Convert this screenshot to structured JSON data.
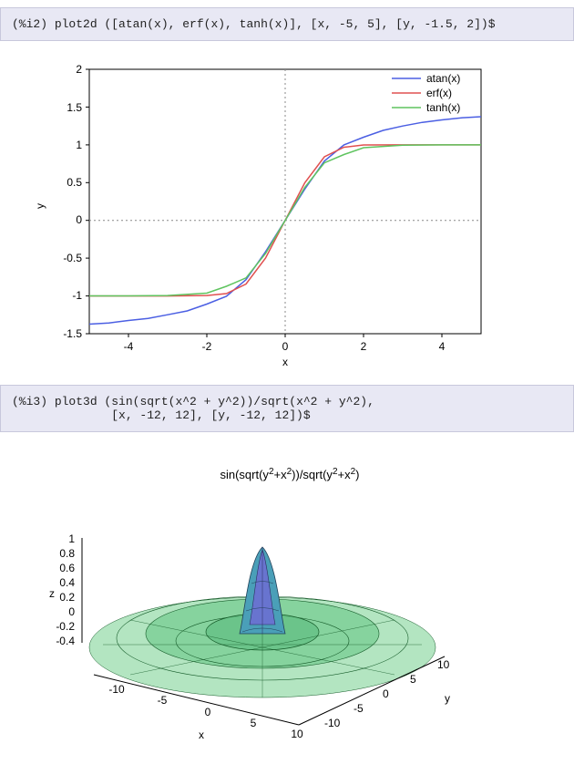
{
  "code1": {
    "prompt": "(%i2)",
    "command": "plot2d ([atan(x), erf(x), tanh(x)], [x, -5, 5], [y, -1.5, 2])$"
  },
  "code2": {
    "prompt": "(%i3)",
    "line1": "plot3d (sin(sqrt(x^2 + y^2))/sqrt(x^2 + y^2),",
    "line2": "        [x, -12, 12], [y, -12, 12])$"
  },
  "plot2d": {
    "xlabel": "x",
    "ylabel": "y",
    "xticks": [
      "-4",
      "-2",
      "0",
      "2",
      "4"
    ],
    "yticks": [
      "-1.5",
      "-1",
      "-0.5",
      "0",
      "0.5",
      "1",
      "1.5",
      "2"
    ],
    "legend": [
      "atan(x)",
      "erf(x)",
      "tanh(x)"
    ],
    "legend_colors": [
      "#4b5fe3",
      "#e05050",
      "#5fc45f"
    ]
  },
  "plot3d": {
    "title_a": "sin(sqrt(y",
    "title_b": "2",
    "title_c": "+x",
    "title_d": "2",
    "title_e": "))/sqrt(y",
    "title_f": "2",
    "title_g": "+x",
    "title_h": "2",
    "title_i": ")",
    "zlabel": "z",
    "xlabel": "x",
    "ylabel": "y",
    "zticks": [
      "1",
      "0.8",
      "0.6",
      "0.4",
      "0.2",
      "0",
      "-0.2",
      "-0.4"
    ],
    "xticks": [
      "-10",
      "-5",
      "0",
      "5",
      "10"
    ],
    "yticks": [
      "-10",
      "-5",
      "0",
      "5",
      "10"
    ]
  },
  "chart_data": [
    {
      "type": "line",
      "title": "",
      "xlabel": "x",
      "ylabel": "y",
      "xlim": [
        -5,
        5
      ],
      "ylim": [
        -1.5,
        2
      ],
      "x": [
        -5,
        -4,
        -3,
        -2,
        -1,
        0,
        1,
        2,
        3,
        4,
        5
      ],
      "series": [
        {
          "name": "atan(x)",
          "color": "#4b5fe3",
          "values": [
            -1.373,
            -1.326,
            -1.249,
            -1.107,
            -0.785,
            0,
            0.785,
            1.107,
            1.249,
            1.326,
            1.373
          ]
        },
        {
          "name": "erf(x)",
          "color": "#e05050",
          "values": [
            -1.0,
            -1.0,
            -1.0,
            -0.995,
            -0.843,
            0,
            0.843,
            0.995,
            1.0,
            1.0,
            1.0
          ]
        },
        {
          "name": "tanh(x)",
          "color": "#5fc45f",
          "values": [
            -1.0,
            -0.999,
            -0.995,
            -0.964,
            -0.762,
            0,
            0.762,
            0.964,
            0.995,
            0.999,
            1.0
          ]
        }
      ]
    },
    {
      "type": "surface",
      "title": "sin(sqrt(y^2+x^2))/sqrt(y^2+x^2)",
      "xlabel": "x",
      "ylabel": "y",
      "zlabel": "z",
      "xlim": [
        -12,
        12
      ],
      "ylim": [
        -12,
        12
      ],
      "zlim": [
        -0.4,
        1
      ],
      "function": "sin(sqrt(x^2+y^2))/sqrt(x^2+y^2)"
    }
  ]
}
